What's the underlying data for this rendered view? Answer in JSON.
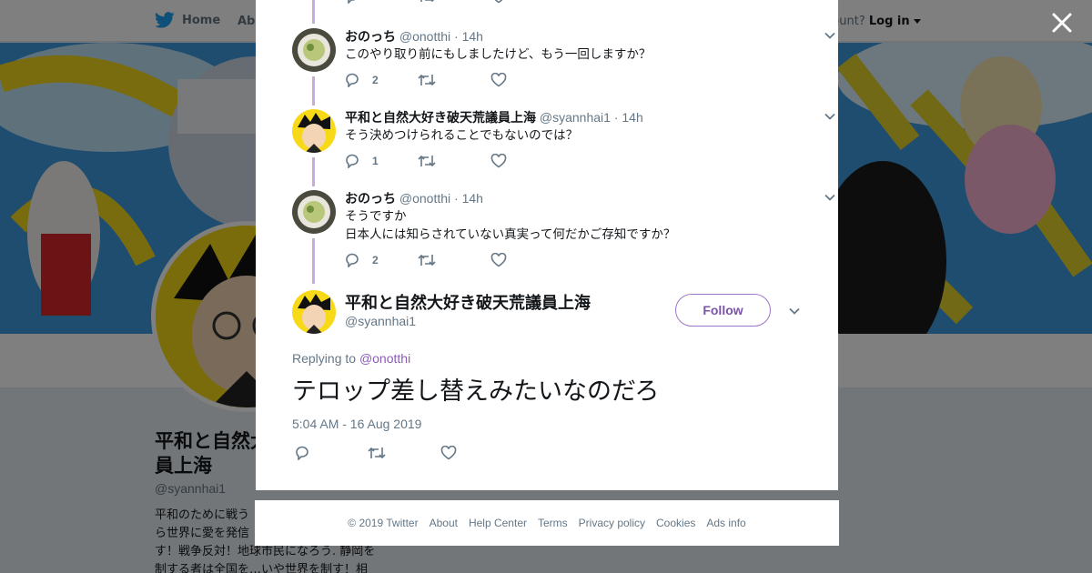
{
  "background": {
    "nav": {
      "home_label": "Home",
      "about_label": "Abo",
      "account_prompt": "ccount?",
      "login_label": "Log in"
    },
    "profile": {
      "name": "平和と自然大",
      "name_line2": "員上海",
      "handle": "@syannhai1",
      "bio_lines": [
        "平和のために戦う",
        "ら世界に愛を発信",
        "す！戦争反対！地球市民になろう. 静岡を",
        "制する者は全国を…いや世界を制す！相"
      ]
    }
  },
  "modal": {
    "close_icon": "close-icon",
    "thread": [
      {
        "name": "おのっち",
        "handle": "@onotthi",
        "time": "14h",
        "lines": [
          "このやり取り前にもしましたけど、もう一回しますか？"
        ],
        "reply_count": "2",
        "avatar": "food-photo"
      },
      {
        "name": "平和と自然大好き破天荒議員上海",
        "handle": "@syannhai1",
        "time": "14h",
        "lines": [
          "そう決めつけられることでもないのでは？"
        ],
        "reply_count": "1",
        "avatar": "cartoon-face"
      },
      {
        "name": "おのっち",
        "handle": "@onotthi",
        "time": "14h",
        "lines": [
          "そうですか",
          "日本人には知らされていない真実って何だかご存知ですか？"
        ],
        "reply_count": "2",
        "avatar": "food-photo"
      }
    ],
    "top_partial_reply_count": "1",
    "main_tweet": {
      "name": "平和と自然大好き破天荒議員上海",
      "handle": "@syannhai1",
      "follow_label": "Follow",
      "replying_prefix": "Replying to",
      "replying_to": "@onotthi",
      "text": "テロップ差し替えみたいなのだろ",
      "timestamp": "5:04 AM - 16 Aug 2019"
    }
  },
  "footer": {
    "copyright": "© 2019 Twitter",
    "links": [
      "About",
      "Help Center",
      "Terms",
      "Privacy policy",
      "Cookies",
      "Ads info"
    ]
  },
  "colors": {
    "accent": "#9f75c9",
    "mention": "#8a5bb8",
    "thread_line": "#c9a9e0",
    "muted": "#657786"
  }
}
